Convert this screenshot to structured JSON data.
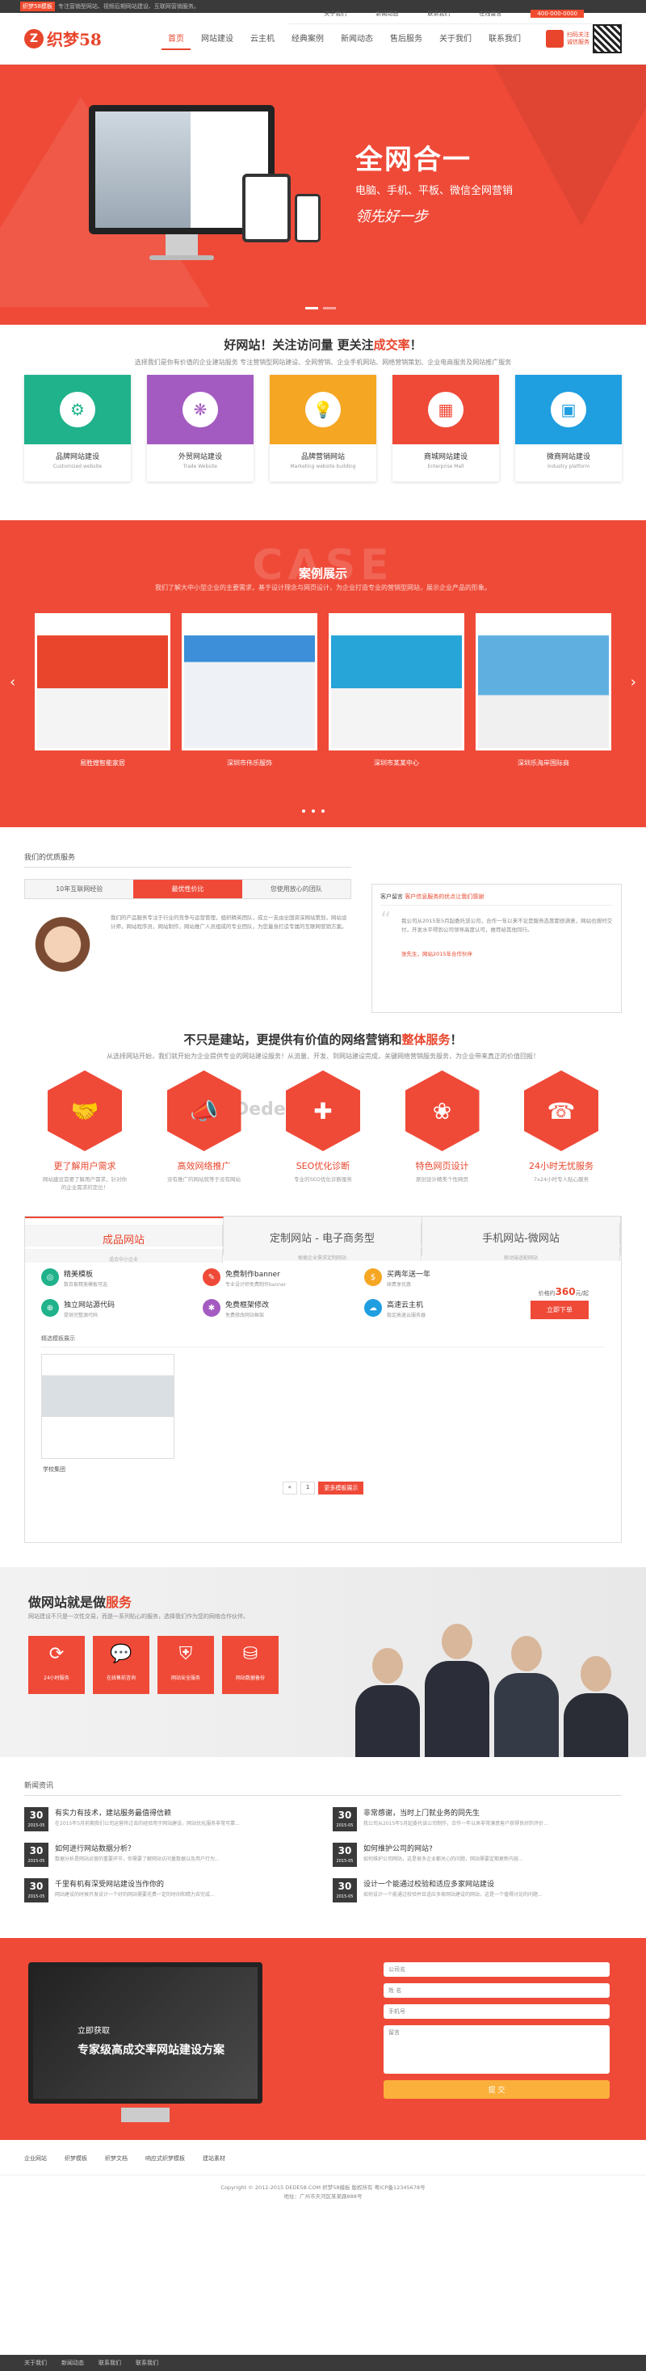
{
  "topbar": {
    "tag": "织梦58模板",
    "text": "专注营销型网站、视频后期网站建设、互联网营销服务。",
    "links": [
      "关于我们",
      "新闻动态",
      "联系我们",
      "在线留言"
    ],
    "phone": "400-000-0000"
  },
  "header": {
    "logo_text": "织梦58",
    "nav": [
      "首页",
      "网站建设",
      "云主机",
      "经典案例",
      "新闻动态",
      "售后服务",
      "关于我们",
      "联系我们"
    ],
    "right_text": "扫码关注 诚信服务"
  },
  "banner": {
    "title": "全网合一",
    "subtitle": "电脑、手机、平板、微信全网营销",
    "slogan": "领先好一步"
  },
  "slogan": {
    "pre": "好网站！关注访问量 更关注",
    "em": "成交率",
    "post": "！",
    "sub": "选择我们是你有价值的企业建站服务 专注营销型网站建设、全网营销、企业手机网站、网络营销策划、企业电商服务及网站推广服务"
  },
  "services": [
    {
      "title": "品牌网站建设",
      "en": "Customized website",
      "color": "#1fb28b",
      "icon": "⚙"
    },
    {
      "title": "外贸网站建设",
      "en": "Trade Website",
      "color": "#a45bc1",
      "icon": "❋"
    },
    {
      "title": "品牌营销网站",
      "en": "Marketing website building",
      "color": "#f5a623",
      "icon": "💡"
    },
    {
      "title": "商城网站建设",
      "en": "Enterprise Mall",
      "color": "#ef4a38",
      "icon": "▦"
    },
    {
      "title": "微商网站建设",
      "en": "Industry platform",
      "color": "#1f9ee0",
      "icon": "▣"
    }
  ],
  "case": {
    "big": "CASE",
    "title": "案例展示",
    "sub": "我们了解大中小型企业的主要需求，基于设计理念与网页设计，为企业打造专业的营销型网站，展示企业产品的形象。",
    "items": [
      "易胜煌智能家居",
      "深圳市伟乐服饰",
      "深圳市某某中心",
      "深圳乐海岸国际商"
    ]
  },
  "advantage": {
    "section": "我们的优质服务",
    "tabs": [
      "10年互联网经验",
      "最优性价比",
      "您使用放心的团队"
    ],
    "text": "我们的产品服务专注于行业的竞争与运营管理，组织精英团队，成立一支由全国资深网站策划，网站设计师，网站程序员，网站制作，网站推广人员组成的专业团队，为您量身打造专属的互联网营销方案。",
    "news_label": "客户留言",
    "news_title": "客户信息服务的优点让我们感谢",
    "news_text": "我公司从2015年5月起委托该公司，合作一年以来不论是服务态度都很满意，网站也按时交付，开发水平得到公司领导高度认可，推荐给其他同行。",
    "news_link": "张先生，网站2015年合作伙伴"
  },
  "serve": {
    "pre": "不只是建站，更提供有价值的网络营销和",
    "em": "整体服务",
    "post": "！",
    "sub": "从选择网站开始，我们就开始为企业提供专业的网站建设服务！从流量、开发、到网站建设完成，关键网络营销服务服务，为企业带来真正的价值回报！",
    "watermark": "Dede58·com",
    "items": [
      {
        "t": "更了解用户需求",
        "d": "网站建设首要了解用户需求，针对你的企业需求的定位！",
        "icon": "🤝"
      },
      {
        "t": "高效网络推广",
        "d": "没有推广的网站就等于没有网站",
        "icon": "📣"
      },
      {
        "t": "SEO优化诊断",
        "d": "专业的SEO优化诊断服务",
        "icon": "✚"
      },
      {
        "t": "特色网页设计",
        "d": "原创设计精美个性网页",
        "icon": "❀"
      },
      {
        "t": "24小时无忧服务",
        "d": "7x24小时专人贴心服务",
        "icon": "☎"
      }
    ]
  },
  "package": {
    "tabs": [
      {
        "t": "成品网站",
        "d": "适合中小企业"
      },
      {
        "t": "定制网站 - 电子商务型",
        "d": "根据企业需求定制网站"
      },
      {
        "t": "手机网站-微网站",
        "d": "移动端适配网站"
      }
    ],
    "feats": [
      {
        "n": "精美模板",
        "d": "数百套精美模板可选",
        "c": "#1fb28b",
        "i": "◎"
      },
      {
        "n": "免费制作banner",
        "d": "专业设计师免费制作banner",
        "c": "#ef4a38",
        "i": "✎"
      },
      {
        "n": "买两年送一年",
        "d": "续费享优惠",
        "c": "#f5a623",
        "i": "$"
      },
      {
        "n": "独立网站源代码",
        "d": "提供完整源代码",
        "c": "#1fb28b",
        "i": "⊕"
      },
      {
        "n": "免费框架修改",
        "d": "免费修改网站框架",
        "c": "#a45bc1",
        "i": "✱"
      },
      {
        "n": "高速云主机",
        "d": "稳定高速云服务器",
        "c": "#1f9ee0",
        "i": "☁"
      }
    ],
    "price_pre": "价格约",
    "price": "360",
    "price_unit": "元/起",
    "buy": "立即下单",
    "tpl_label": "精选模板展示",
    "tpl_name": "学校集团",
    "pager": [
      "«",
      "1",
      "»"
    ],
    "pager_go": "更多模板展示"
  },
  "team": {
    "pre": "做网站就是做",
    "em": "服务",
    "sub": "网站建设不只是一次性交易，而是一系列贴心的服务，选择我们作为您的网络合作伙伴。",
    "tiles": [
      {
        "l": "24小时服务",
        "i": "⟳"
      },
      {
        "l": "在线售前咨询",
        "i": "💬"
      },
      {
        "l": "网站安全服务",
        "i": "⛨"
      },
      {
        "l": "网站数据备份",
        "i": "⛁"
      }
    ]
  },
  "news": {
    "section": "新闻资讯",
    "items": [
      {
        "day": "30",
        "ym": "2015-05",
        "t": "有实力有技术，建站服务最值得信赖",
        "d": "在2015年5月前期我们公司运营将过去的经验用于网站建设，网站优化服务非常可靠..."
      },
      {
        "day": "30",
        "ym": "2015-05",
        "t": "非常感谢，当时上门就业务的同先生",
        "d": "我公司从2015年5月起委托该公司制作，合作一年以来非常满意客户获得良好的评价..."
      },
      {
        "day": "30",
        "ym": "2015-05",
        "t": "如何进行网站数据分析？",
        "d": "数据分析是网站运营的重要环节，你需要了解网站访问量数据以及用户行为..."
      },
      {
        "day": "30",
        "ym": "2015-05",
        "t": "如何维护公司的网站?",
        "d": "如何维护公司网站，这是很多企业都关心的问题，网站需要定期更新内容..."
      },
      {
        "day": "30",
        "ym": "2015-05",
        "t": "千里有机有深受网站建设当作你的",
        "d": "网站建设的时候开发设计一个好的网站需要花费一定的时间和精力去完成..."
      },
      {
        "day": "30",
        "ym": "2015-05",
        "t": "设计一个能通过校验和适应多家网站建设",
        "d": "如何设计一个能通过校验并且适应多家网站建设的网站，这是一个值得讨论的问题..."
      }
    ]
  },
  "contact": {
    "l1": "立即获取",
    "l2": "专家级高成交率网站建设方案",
    "fields": [
      "公司名",
      "姓 名",
      "手机号",
      "留言"
    ],
    "submit": "提 交"
  },
  "footer": {
    "links": [
      "企业网站",
      "织梦模板",
      "织梦文档",
      "响应式织梦模板",
      "建站素材"
    ],
    "copy1": "Copyright © 2012-2015 DEDE58.COM 织梦58模板 版权所有 粤ICP备12345678号",
    "copy2": "地址：广州市天河区某某路888号",
    "bottom": [
      "关于我们",
      "新闻动态",
      "联系我们",
      "联系我们"
    ]
  }
}
